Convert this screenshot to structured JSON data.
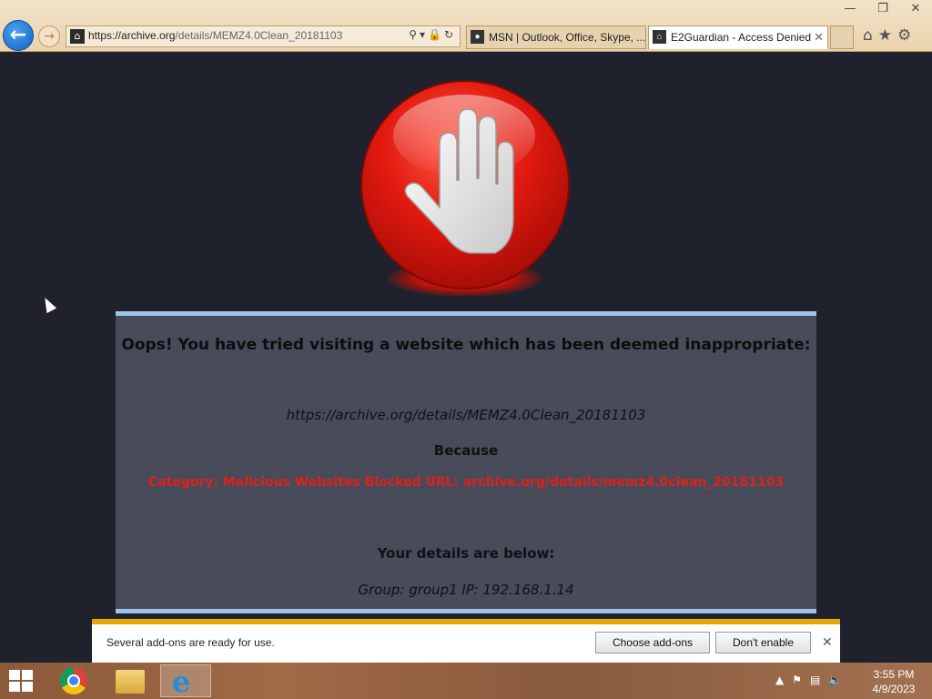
{
  "browser": {
    "back_icon": "back-arrow-icon",
    "forward_icon": "forward-arrow-icon",
    "address": {
      "url_host": "https://archive.org",
      "url_path": "/details/MEMZ4.0Clean_20181103"
    },
    "tabs": [
      {
        "label": "MSN | Outlook, Office, Skype, ...",
        "active": false
      },
      {
        "label": "E2Guardian - Access Denied",
        "active": true
      }
    ],
    "right_icons": [
      "home-icon",
      "star-icon",
      "gear-icon"
    ]
  },
  "block_page": {
    "title": "Oops! You have tried visiting a website which has been deemed inappropriate:",
    "url": "https://archive.org/details/MEMZ4.0Clean_20181103",
    "because": "Because",
    "reason": "Category: Malicious Websites    Blocked URL: archive.org/details/memz4.0clean_20181103",
    "details_heading": "Your details are below:",
    "group_ip": "Group: group1   IP: 192.168.1.14",
    "accent_color": "#e0211a",
    "hand_icon": "stop-hand-icon"
  },
  "notification": {
    "text": "Several add-ons are ready for use.",
    "choose_label": "Choose add-ons",
    "dont_label": "Don't enable"
  },
  "taskbar": {
    "apps": [
      "start-icon",
      "chrome-icon",
      "file-explorer-icon",
      "internet-explorer-icon"
    ],
    "time": "3:55 PM",
    "date": "4/9/2023"
  }
}
